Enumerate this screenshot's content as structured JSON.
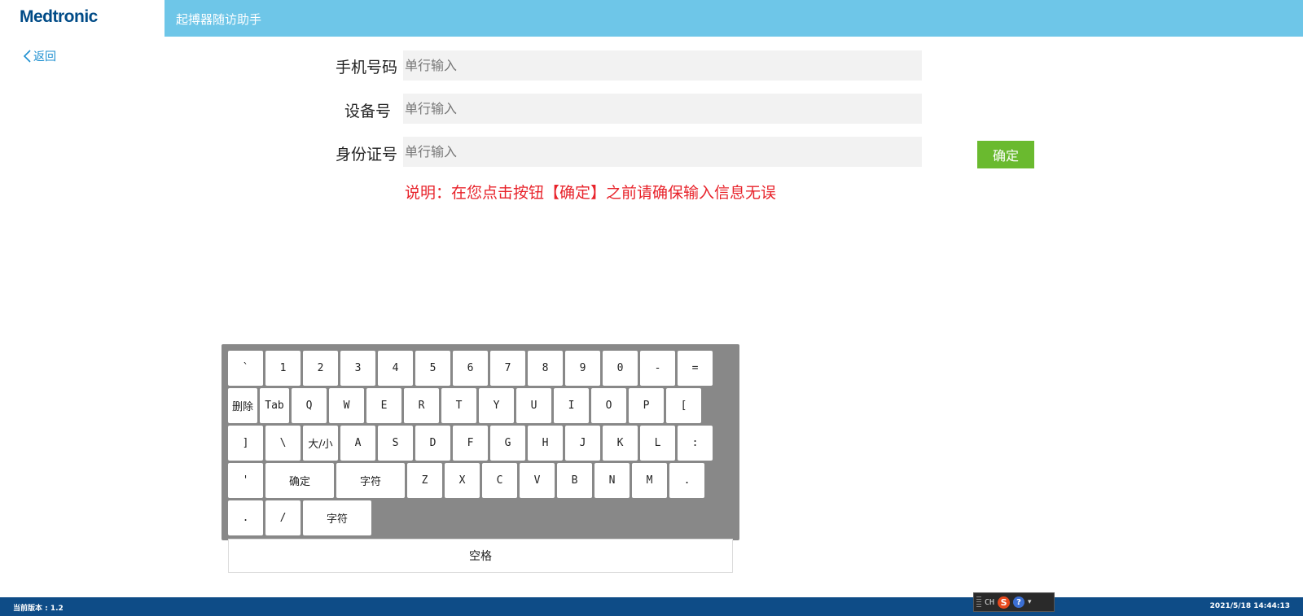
{
  "header": {
    "logo": "Medtronic",
    "title": "起搏器随访助手"
  },
  "nav": {
    "back_label": "返回"
  },
  "form": {
    "fields": [
      {
        "label": "手机号码",
        "placeholder": "单行输入",
        "value": ""
      },
      {
        "label": "设备号",
        "placeholder": "单行输入",
        "value": ""
      },
      {
        "label": "身份证号",
        "placeholder": "单行输入",
        "value": ""
      }
    ],
    "confirm_label": "确定",
    "note": "说明：在您点击按钮【确定】之前请确保输入信息无误"
  },
  "keyboard": {
    "rows": [
      [
        "`",
        "1",
        "2",
        "3",
        "4",
        "5",
        "6",
        "7",
        "8",
        "9",
        "0",
        "-",
        "="
      ],
      [
        "删除",
        "Tab",
        "Q",
        "W",
        "E",
        "R",
        "T",
        "Y",
        "U",
        "I",
        "O",
        "P",
        "["
      ],
      [
        "]",
        "\\",
        "大/小",
        "A",
        "S",
        "D",
        "F",
        "G",
        "H",
        "J",
        "K",
        "L",
        ":"
      ],
      [
        "'",
        "确定",
        "字符",
        "Z",
        "X",
        "C",
        "V",
        "B",
        "N",
        "M",
        "."
      ],
      [
        ".",
        "/",
        "字符"
      ]
    ],
    "space_label": "空格"
  },
  "footer": {
    "version": "当前版本 : 1.2",
    "datetime": "2021/5/18 14:44:13"
  },
  "ime": {
    "lang": "CH",
    "icons": [
      "sogou-icon",
      "help-icon",
      "menu-arrow-icon"
    ]
  },
  "colors": {
    "header": "#6ec6e8",
    "confirm": "#6aba2f",
    "note": "#e8232b",
    "footer": "#0e4c87",
    "keyboard_bg": "#888888"
  }
}
